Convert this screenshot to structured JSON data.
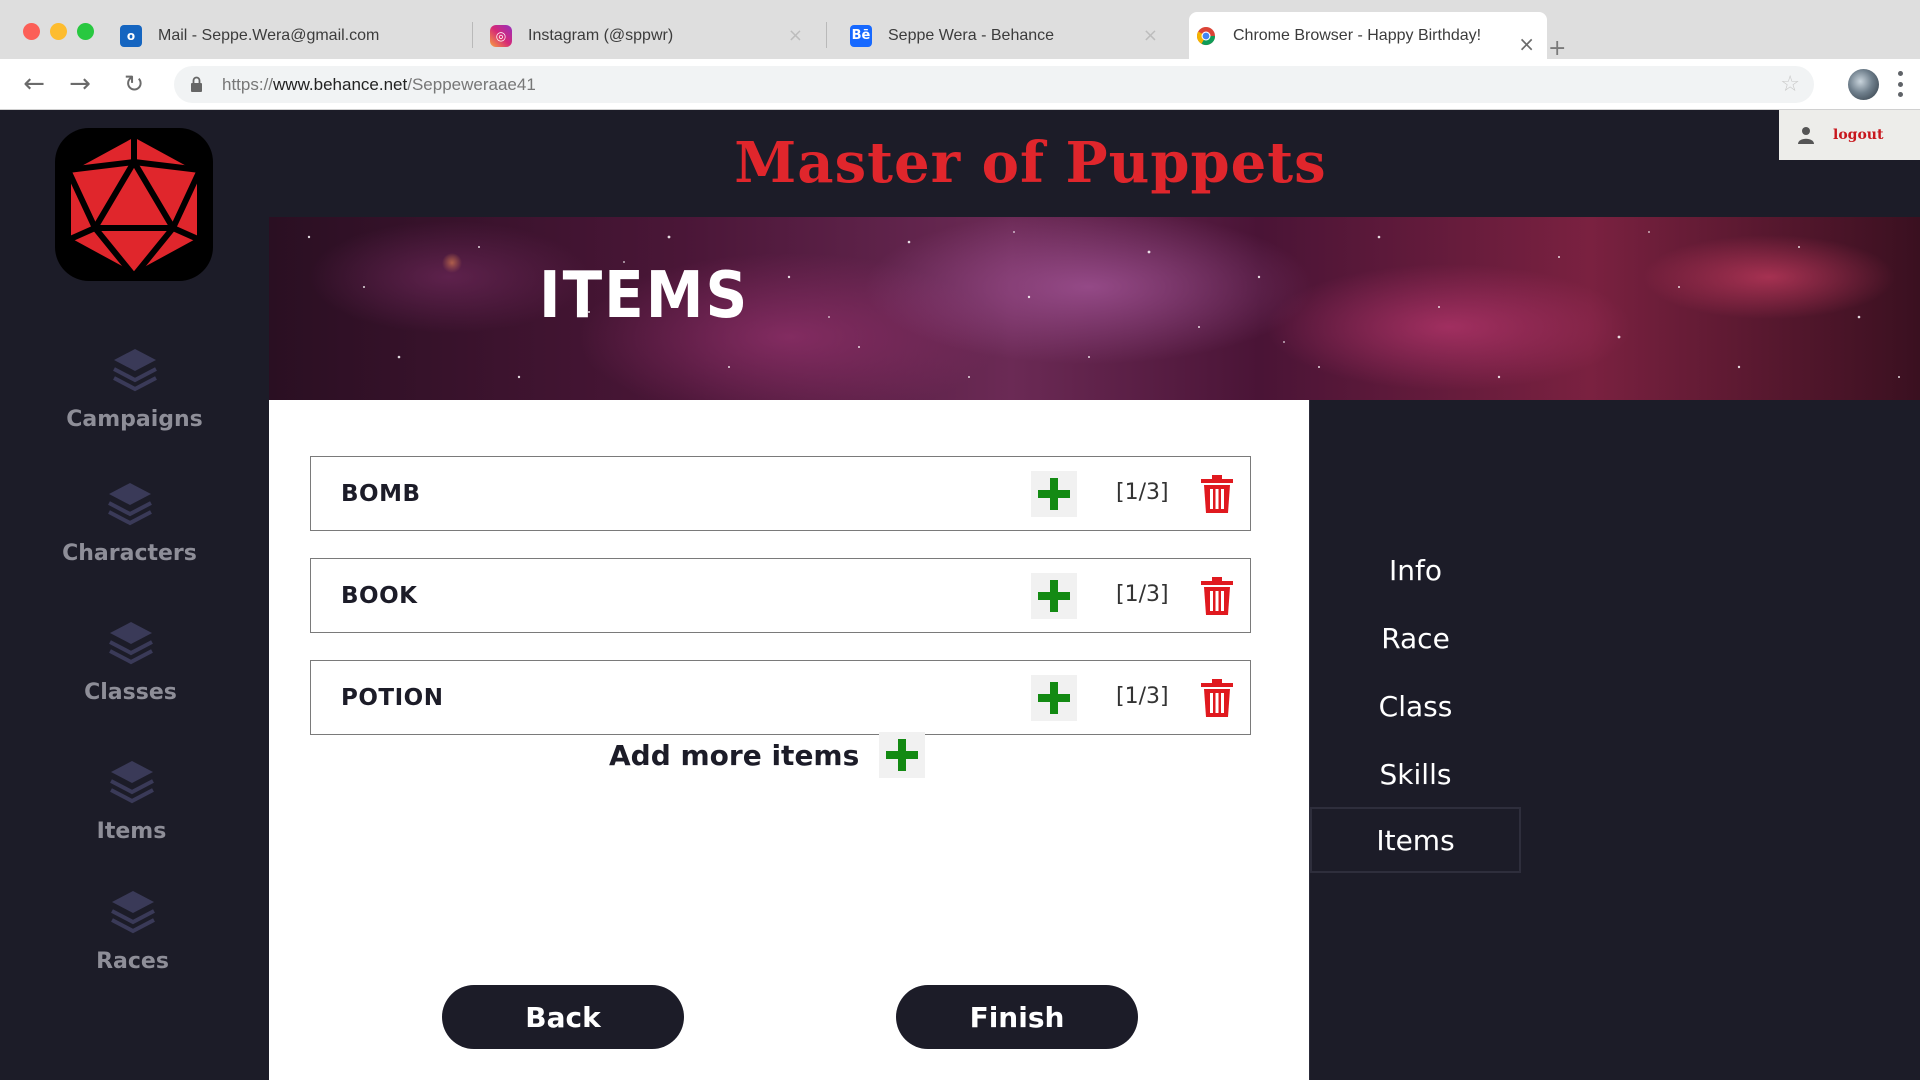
{
  "browser": {
    "tabs": [
      {
        "title": "Mail - Seppe.Wera@gmail.com",
        "icon": "outlook-icon"
      },
      {
        "title": "Instagram (@sppwr)",
        "icon": "instagram-icon"
      },
      {
        "title": "Seppe Wera - Behance",
        "icon": "behance-icon",
        "fav_text": "Bē"
      },
      {
        "title": "Chrome Browser - Happy Birthday!",
        "icon": "chrome-icon"
      }
    ],
    "url_prefix": "https://",
    "url_domain": "www.behance.net",
    "url_path": "/Seppeweraae41"
  },
  "app": {
    "title": "Master of Puppets",
    "logout_label": "logout",
    "banner_title": "ITEMS",
    "sidebar": [
      {
        "label": "Campaigns",
        "icon": "layers-icon"
      },
      {
        "label": "Characters",
        "icon": "layers-icon"
      },
      {
        "label": "Classes",
        "icon": "layers-icon"
      },
      {
        "label": "Items",
        "icon": "layers-icon"
      },
      {
        "label": "Races",
        "icon": "layers-icon"
      }
    ],
    "items": [
      {
        "name": "BOMB",
        "count": "[1/3]"
      },
      {
        "name": "BOOK",
        "count": "[1/3]"
      },
      {
        "name": "POTION",
        "count": "[1/3]"
      }
    ],
    "add_more_label": "Add more items",
    "back_label": "Back",
    "finish_label": "Finish",
    "right_nav": [
      {
        "label": "Info"
      },
      {
        "label": "Race"
      },
      {
        "label": "Class"
      },
      {
        "label": "Skills"
      },
      {
        "label": "Items",
        "active": true
      }
    ],
    "colors": {
      "background": "#1c1c28",
      "accent_red": "#e0262c",
      "plus_green": "#138a13",
      "trash_red": "#e0191f"
    }
  }
}
